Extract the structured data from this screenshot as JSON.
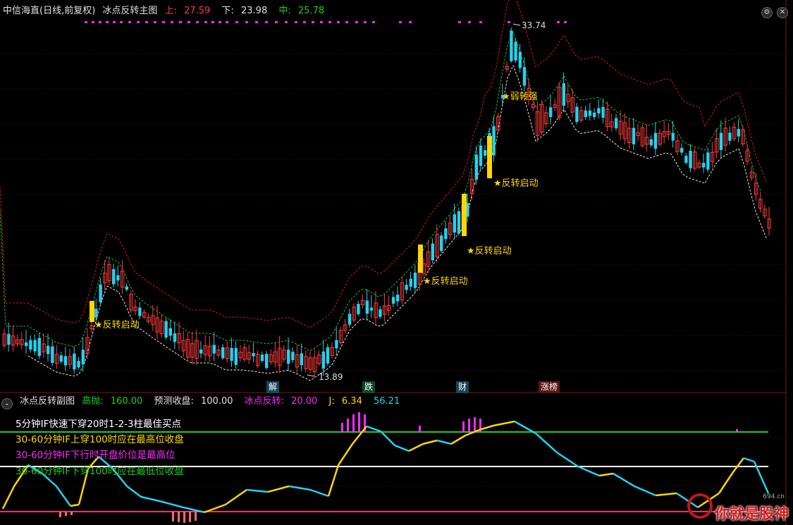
{
  "main_panel": {
    "title": "中信海直(日线,前复权)",
    "indicator": "冰点反转主图",
    "high_label": "上:",
    "high_value": "27.59",
    "low_label": "下:",
    "low_value": "23.98",
    "mid_label": "中:",
    "mid_value": "25.78",
    "price_max_label": "33.74",
    "price_min_label": "13.89",
    "signals": [
      {
        "text": "★反转启动"
      },
      {
        "text": "★反转启动"
      },
      {
        "text": "★反转启动"
      },
      {
        "text": "★反转启动"
      },
      {
        "text": "★弱转强"
      }
    ],
    "event_tags": [
      "解",
      "跌",
      "财",
      "涨榜"
    ]
  },
  "sub_panel": {
    "title": "冰点反转副图",
    "items": [
      {
        "label": "高抛:",
        "value": "160.00"
      },
      {
        "label": "预测收盘:",
        "value": "100.00"
      },
      {
        "label": "冰点反转:",
        "value": "20.00"
      },
      {
        "label": "J:",
        "value": "6.34"
      },
      {
        "label": "",
        "value": "56.21"
      }
    ],
    "legend": [
      "5分钟IF快速下穿20时1-2-3柱最佳买点",
      "30-60分钟IF上穿100时应在最高位收盘",
      "30-60分钟IF下行时开盘价位是最高位",
      "30-60分钟IF下穿100时应在最低位收盘"
    ]
  },
  "controls": {
    "settings_icon": "⚙",
    "close_icon": "✕",
    "collapse_icon": "⌄"
  },
  "watermark": {
    "text": "你就是股神",
    "url": "694.cn"
  },
  "colors": {
    "up": "#ff3b3b",
    "down": "#22d3ee",
    "yellow": "#ffd700",
    "green_line": "#22cc22",
    "white_line": "#ffffff",
    "magenta": "#ff2aff",
    "pink_line": "#ff2a7a"
  }
}
